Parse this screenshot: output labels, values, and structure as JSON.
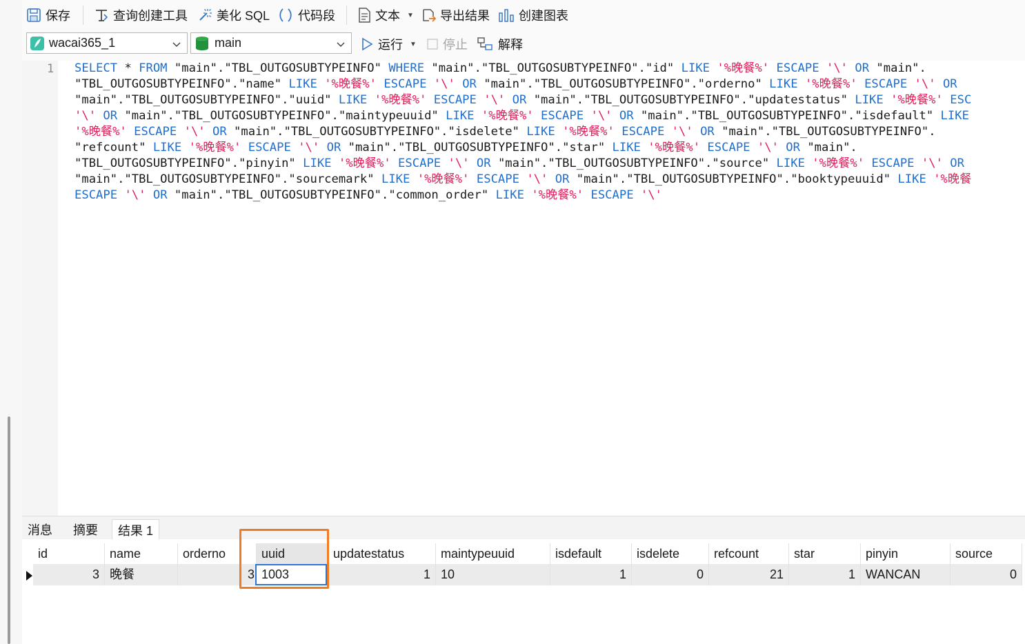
{
  "toolbar": {
    "save": "保存",
    "query_builder": "查询创建工具",
    "beautify": "美化 SQL",
    "snippet": "代码段",
    "text": "文本",
    "export": "导出结果",
    "chart": "创建图表"
  },
  "toolbar2": {
    "connection": "wacai365_1",
    "schema": "main",
    "run": "运行",
    "stop": "停止",
    "explain": "解释"
  },
  "editor": {
    "line_number": "1",
    "code_lines": [
      [
        [
          "kw",
          "SELECT"
        ],
        [
          "t",
          " * "
        ],
        [
          "kw",
          "FROM"
        ],
        [
          "t",
          " \"main\".\"TBL_OUTGOSUBTYPEINFO\" "
        ],
        [
          "kw",
          "WHERE"
        ],
        [
          "t",
          " \"main\".\"TBL_OUTGOSUBTYPEINFO\".\"id\" "
        ],
        [
          "kw",
          "LIKE"
        ],
        [
          "t",
          " "
        ],
        [
          "str",
          "'%晚餐%'"
        ],
        [
          "t",
          " "
        ],
        [
          "kw",
          "ESCAPE"
        ],
        [
          "t",
          " "
        ],
        [
          "str",
          "'\\'"
        ],
        [
          "t",
          " "
        ],
        [
          "kw",
          "OR"
        ],
        [
          "t",
          " \"main\"."
        ]
      ],
      [
        [
          "t",
          "\"TBL_OUTGOSUBTYPEINFO\".\"name\" "
        ],
        [
          "kw",
          "LIKE"
        ],
        [
          "t",
          " "
        ],
        [
          "str",
          "'%晚餐%'"
        ],
        [
          "t",
          " "
        ],
        [
          "kw",
          "ESCAPE"
        ],
        [
          "t",
          " "
        ],
        [
          "str",
          "'\\'"
        ],
        [
          "t",
          " "
        ],
        [
          "kw",
          "OR"
        ],
        [
          "t",
          " \"main\".\"TBL_OUTGOSUBTYPEINFO\".\"orderno\" "
        ],
        [
          "kw",
          "LIKE"
        ],
        [
          "t",
          " "
        ],
        [
          "str",
          "'%晚餐%'"
        ],
        [
          "t",
          " "
        ],
        [
          "kw",
          "ESCAPE"
        ],
        [
          "t",
          " "
        ],
        [
          "str",
          "'\\'"
        ],
        [
          "t",
          " "
        ],
        [
          "kw",
          "OR"
        ]
      ],
      [
        [
          "t",
          "\"main\".\"TBL_OUTGOSUBTYPEINFO\".\"uuid\" "
        ],
        [
          "kw",
          "LIKE"
        ],
        [
          "t",
          " "
        ],
        [
          "str",
          "'%晚餐%'"
        ],
        [
          "t",
          " "
        ],
        [
          "kw",
          "ESCAPE"
        ],
        [
          "t",
          " "
        ],
        [
          "str",
          "'\\'"
        ],
        [
          "t",
          " "
        ],
        [
          "kw",
          "OR"
        ],
        [
          "t",
          " \"main\".\"TBL_OUTGOSUBTYPEINFO\".\"updatestatus\" "
        ],
        [
          "kw",
          "LIKE"
        ],
        [
          "t",
          " "
        ],
        [
          "str",
          "'%晚餐%'"
        ],
        [
          "t",
          " "
        ],
        [
          "kw",
          "ESC"
        ]
      ],
      [
        [
          "str",
          "'\\'"
        ],
        [
          "t",
          " "
        ],
        [
          "kw",
          "OR"
        ],
        [
          "t",
          " \"main\".\"TBL_OUTGOSUBTYPEINFO\".\"maintypeuuid\" "
        ],
        [
          "kw",
          "LIKE"
        ],
        [
          "t",
          " "
        ],
        [
          "str",
          "'%晚餐%'"
        ],
        [
          "t",
          " "
        ],
        [
          "kw",
          "ESCAPE"
        ],
        [
          "t",
          " "
        ],
        [
          "str",
          "'\\'"
        ],
        [
          "t",
          " "
        ],
        [
          "kw",
          "OR"
        ],
        [
          "t",
          " \"main\".\"TBL_OUTGOSUBTYPEINFO\".\"isdefault\" "
        ],
        [
          "kw",
          "LIKE"
        ]
      ],
      [
        [
          "str",
          "'%晚餐%'"
        ],
        [
          "t",
          " "
        ],
        [
          "kw",
          "ESCAPE"
        ],
        [
          "t",
          " "
        ],
        [
          "str",
          "'\\'"
        ],
        [
          "t",
          " "
        ],
        [
          "kw",
          "OR"
        ],
        [
          "t",
          " \"main\".\"TBL_OUTGOSUBTYPEINFO\".\"isdelete\" "
        ],
        [
          "kw",
          "LIKE"
        ],
        [
          "t",
          " "
        ],
        [
          "str",
          "'%晚餐%'"
        ],
        [
          "t",
          " "
        ],
        [
          "kw",
          "ESCAPE"
        ],
        [
          "t",
          " "
        ],
        [
          "str",
          "'\\'"
        ],
        [
          "t",
          " "
        ],
        [
          "kw",
          "OR"
        ],
        [
          "t",
          " \"main\".\"TBL_OUTGOSUBTYPEINFO\"."
        ]
      ],
      [
        [
          "t",
          "\"refcount\" "
        ],
        [
          "kw",
          "LIKE"
        ],
        [
          "t",
          " "
        ],
        [
          "str",
          "'%晚餐%'"
        ],
        [
          "t",
          " "
        ],
        [
          "kw",
          "ESCAPE"
        ],
        [
          "t",
          " "
        ],
        [
          "str",
          "'\\'"
        ],
        [
          "t",
          " "
        ],
        [
          "kw",
          "OR"
        ],
        [
          "t",
          " \"main\".\"TBL_OUTGOSUBTYPEINFO\".\"star\" "
        ],
        [
          "kw",
          "LIKE"
        ],
        [
          "t",
          " "
        ],
        [
          "str",
          "'%晚餐%'"
        ],
        [
          "t",
          " "
        ],
        [
          "kw",
          "ESCAPE"
        ],
        [
          "t",
          " "
        ],
        [
          "str",
          "'\\'"
        ],
        [
          "t",
          " "
        ],
        [
          "kw",
          "OR"
        ],
        [
          "t",
          " \"main\"."
        ]
      ],
      [
        [
          "t",
          "\"TBL_OUTGOSUBTYPEINFO\".\"pinyin\" "
        ],
        [
          "kw",
          "LIKE"
        ],
        [
          "t",
          " "
        ],
        [
          "str",
          "'%晚餐%'"
        ],
        [
          "t",
          " "
        ],
        [
          "kw",
          "ESCAPE"
        ],
        [
          "t",
          " "
        ],
        [
          "str",
          "'\\'"
        ],
        [
          "t",
          " "
        ],
        [
          "kw",
          "OR"
        ],
        [
          "t",
          " \"main\".\"TBL_OUTGOSUBTYPEINFO\".\"source\" "
        ],
        [
          "kw",
          "LIKE"
        ],
        [
          "t",
          " "
        ],
        [
          "str",
          "'%晚餐%'"
        ],
        [
          "t",
          " "
        ],
        [
          "kw",
          "ESCAPE"
        ],
        [
          "t",
          " "
        ],
        [
          "str",
          "'\\'"
        ],
        [
          "t",
          " "
        ],
        [
          "kw",
          "OR"
        ]
      ],
      [
        [
          "t",
          "\"main\".\"TBL_OUTGOSUBTYPEINFO\".\"sourcemark\" "
        ],
        [
          "kw",
          "LIKE"
        ],
        [
          "t",
          " "
        ],
        [
          "str",
          "'%晚餐%'"
        ],
        [
          "t",
          " "
        ],
        [
          "kw",
          "ESCAPE"
        ],
        [
          "t",
          " "
        ],
        [
          "str",
          "'\\'"
        ],
        [
          "t",
          " "
        ],
        [
          "kw",
          "OR"
        ],
        [
          "t",
          " \"main\".\"TBL_OUTGOSUBTYPEINFO\".\"booktypeuuid\" "
        ],
        [
          "kw",
          "LIKE"
        ],
        [
          "t",
          " "
        ],
        [
          "str",
          "'%晚餐"
        ]
      ],
      [
        [
          "kw",
          "ESCAPE"
        ],
        [
          "t",
          " "
        ],
        [
          "str",
          "'\\'"
        ],
        [
          "t",
          " "
        ],
        [
          "kw",
          "OR"
        ],
        [
          "t",
          " \"main\".\"TBL_OUTGOSUBTYPEINFO\".\"common_order\" "
        ],
        [
          "kw",
          "LIKE"
        ],
        [
          "t",
          " "
        ],
        [
          "str",
          "'%晚餐%'"
        ],
        [
          "t",
          " "
        ],
        [
          "kw",
          "ESCAPE"
        ],
        [
          "t",
          " "
        ],
        [
          "str",
          "'\\'"
        ]
      ]
    ]
  },
  "result_tabs": [
    "消息",
    "摘要",
    "结果 1"
  ],
  "grid": {
    "columns": [
      "id",
      "name",
      "orderno",
      "uuid",
      "updatestatus",
      "maintypeuuid",
      "isdefault",
      "isdelete",
      "refcount",
      "star",
      "pinyin",
      "source"
    ],
    "row": [
      "3",
      "晚餐",
      "3",
      "1003",
      "1",
      "10",
      "1",
      "0",
      "21",
      "1",
      "WANCAN",
      "0"
    ]
  },
  "colors": {
    "keyword": "#1f6fd1",
    "string": "#e0205a",
    "highlight": "#f07b24",
    "edit_border": "#2f74d0"
  }
}
